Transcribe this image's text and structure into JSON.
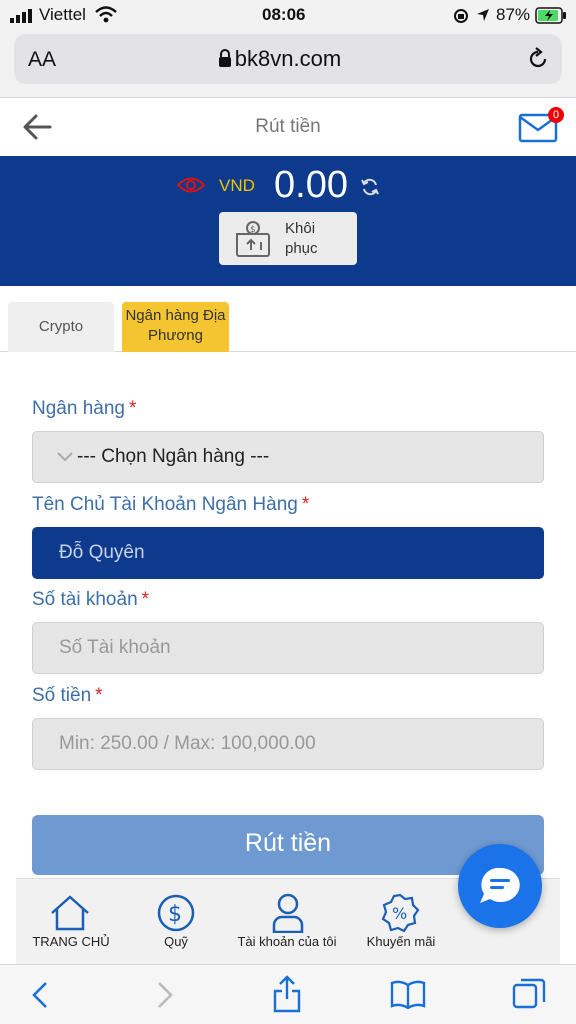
{
  "status_bar": {
    "carrier": "Viettel",
    "time": "08:06",
    "battery": "87%"
  },
  "browser": {
    "text_size_label": "AA",
    "url": "bk8vn.com"
  },
  "header": {
    "title": "Rút tiền",
    "mail_badge": "0"
  },
  "balance": {
    "currency": "VND",
    "amount": "0.00",
    "restore_label": "Khôi phục"
  },
  "tabs": [
    {
      "label": "Crypto",
      "active": false
    },
    {
      "label": "Ngân hàng Địa Phương",
      "active": true
    }
  ],
  "form": {
    "bank_label": "Ngân hàng",
    "bank_select": "--- Chọn Ngân hàng ---",
    "holder_label": "Tên Chủ Tài Khoản Ngân Hàng",
    "holder_value": "Đỗ Quyên",
    "account_label": "Số tài khoản",
    "account_placeholder": "Số Tài khoản",
    "amount_label": "Số tiền",
    "amount_placeholder": "Min: 250.00 / Max: 100,000.00",
    "required_mark": "*",
    "submit_label": "Rút tiền"
  },
  "bottom_nav": [
    {
      "label": "TRANG CHỦ",
      "icon": "home-icon"
    },
    {
      "label": "Quỹ",
      "icon": "dollar-icon"
    },
    {
      "label": "Tài khoản của tôi",
      "icon": "user-icon"
    },
    {
      "label": "Khuyến mãi",
      "icon": "percent-badge-icon"
    }
  ],
  "colors": {
    "brand_blue": "#0d3a8c",
    "accent_yellow": "#f5c431",
    "link_blue": "#3e6fa8",
    "submit_blue": "#6f9ad1",
    "fab_blue": "#1a73e8"
  }
}
